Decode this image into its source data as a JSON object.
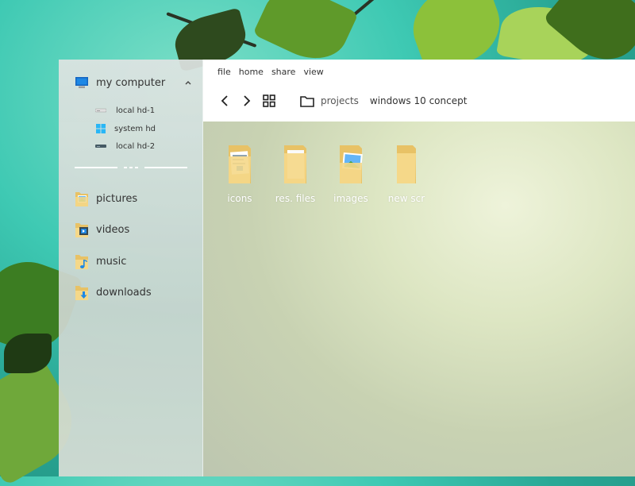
{
  "menu": [
    "file",
    "home",
    "share",
    "view"
  ],
  "breadcrumb": [
    "projects",
    "windows 10 concept"
  ],
  "sidebar": {
    "computer_label": "my computer",
    "drives": [
      "local hd-1",
      "system hd",
      "local hd-2"
    ],
    "libraries": [
      "pictures",
      "videos",
      "music",
      "downloads"
    ]
  },
  "files": [
    "icons",
    "res. files",
    "images",
    "new scr"
  ],
  "colors": {
    "folder": "#f5d889",
    "folder_dark": "#e8c266",
    "accent_blue": "#1e88e5"
  },
  "icons": {
    "computer": "monitor-icon",
    "collapse": "chevron-up-icon",
    "back": "chevron-left-icon",
    "forward": "chevron-right-icon",
    "view": "grid-icon",
    "breadcrumb": "folder-outline-icon"
  }
}
